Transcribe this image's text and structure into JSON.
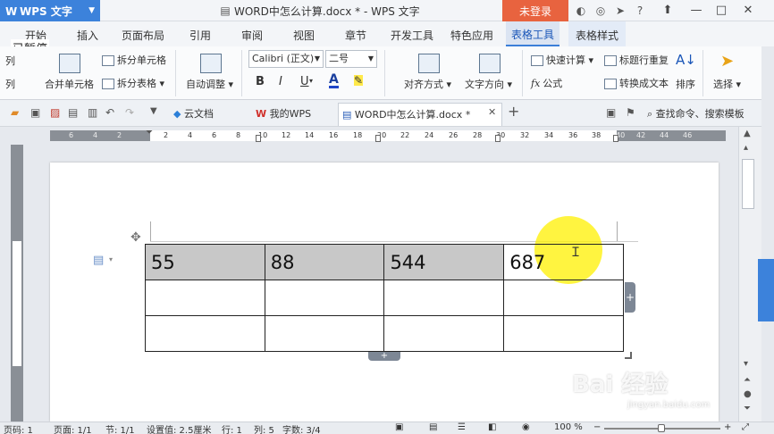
{
  "app": {
    "menu_button": "WPS 文字",
    "doc_title": "WORD中怎么计算.docx * - WPS 文字",
    "login": "未登录",
    "paused": "已暂停"
  },
  "tabs": [
    "开始",
    "插入",
    "页面布局",
    "引用",
    "审阅",
    "视图",
    "章节",
    "开发工具",
    "特色应用",
    "表格工具",
    "表格样式"
  ],
  "active_tab": "表格工具",
  "ribbon": {
    "merge_cells": "合并单元格",
    "split_cells": "拆分单元格",
    "split_table": "拆分表格",
    "autofit": "自动调整",
    "font_name": "Calibri (正文)",
    "font_size": "二号",
    "bold": "B",
    "italic": "I",
    "underline": "U",
    "font_color": "A",
    "align": "对齐方式",
    "text_direction": "文字方向",
    "quick_calc": "快速计算",
    "formula": "公式",
    "header_repeat": "标题行重复",
    "convert_text": "转换成文本",
    "sort": "排序",
    "select": "选择",
    "col_label": "列"
  },
  "doc_tabs": [
    {
      "label": "云文档",
      "icon": "cloud-icon"
    },
    {
      "label": "我的WPS",
      "icon": "wps-icon"
    },
    {
      "label": "WORD中怎么计算.docx *",
      "icon": "doc-icon"
    }
  ],
  "search_cmd": "查找命令、搜索模板",
  "ruler": {
    "left_nums": [
      "6",
      "4",
      "2"
    ],
    "right_nums": [
      "2",
      "4",
      "6",
      "8",
      "10",
      "12",
      "14",
      "16",
      "18",
      "20",
      "22",
      "24",
      "26",
      "28",
      "30",
      "32",
      "34",
      "36",
      "38",
      "40",
      "42",
      "44",
      "46"
    ]
  },
  "table": {
    "rows": [
      [
        "55",
        "88",
        "544",
        "687"
      ],
      [
        "",
        "",
        "",
        ""
      ],
      [
        "",
        "",
        "",
        ""
      ]
    ]
  },
  "status": {
    "page": "页码: 1",
    "pages": "页面: 1/1",
    "section": "节: 1/1",
    "settings": "设置值: 2.5厘米",
    "row": "行: 1",
    "col": "列: 5",
    "words": "字数: 3/4",
    "zoom": "100 %"
  },
  "watermark": {
    "main": "Bai 经验",
    "sub": "jingyan.baidu.com"
  }
}
